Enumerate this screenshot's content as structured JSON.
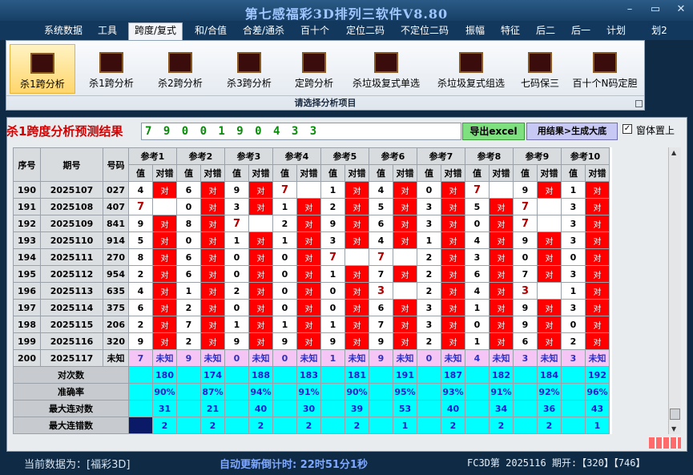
{
  "window": {
    "title": "第七感福彩3D排列三软件V8.80",
    "minimize": "–",
    "restore": "▭",
    "close": "✕"
  },
  "menu": [
    "系统数据",
    "工具",
    "跨度/复式",
    "和/合值",
    "合差/通杀",
    "百十个",
    "定位二码",
    "不定位二码",
    "振幅",
    "特征",
    "后二",
    "后一",
    "计划",
    "划2"
  ],
  "menu_active_index": 2,
  "ribbon": {
    "buttons": [
      "杀1跨分析",
      "杀1跨分析",
      "杀2跨分析",
      "杀3跨分析",
      "定跨分析",
      "杀垃圾复式单选",
      "杀垃圾复式组选",
      "七码保三",
      "百十个N码定胆"
    ],
    "selected_index": 0,
    "caption": "请选择分析项目"
  },
  "prediction": {
    "title": "杀1跨度分析预测结果",
    "result": "7 9 0 0 1 9 0 4 3 3",
    "export_button": "导出excel",
    "generate_button": "用结果>生成大底",
    "pin_label": "窗体置上",
    "pin_checked": "✓"
  },
  "table": {
    "headers": {
      "seq": "序号",
      "period": "期号",
      "number": "号码"
    },
    "refs": [
      "参考1",
      "参考2",
      "参考3",
      "参考4",
      "参考5",
      "参考6",
      "参考7",
      "参考8",
      "参考9",
      "参考10"
    ],
    "sub_value": "值",
    "sub_result": "对错",
    "hit_text": "对",
    "rows": [
      {
        "seq": "190",
        "period": "2025107",
        "number": "027",
        "cells": [
          [
            "4",
            "h"
          ],
          [
            "6",
            "h"
          ],
          [
            "9",
            "h"
          ],
          [
            "7",
            "m"
          ],
          [
            "1",
            "h"
          ],
          [
            "4",
            "h"
          ],
          [
            "0",
            "h"
          ],
          [
            "7",
            "m"
          ],
          [
            "9",
            "h"
          ],
          [
            "1",
            "h"
          ]
        ]
      },
      {
        "seq": "191",
        "period": "2025108",
        "number": "407",
        "cells": [
          [
            "7",
            "m"
          ],
          [
            "0",
            "h"
          ],
          [
            "3",
            "h"
          ],
          [
            "1",
            "h"
          ],
          [
            "2",
            "h"
          ],
          [
            "5",
            "h"
          ],
          [
            "3",
            "h"
          ],
          [
            "5",
            "h"
          ],
          [
            "7",
            "m"
          ],
          [
            "3",
            "h"
          ]
        ]
      },
      {
        "seq": "192",
        "period": "2025109",
        "number": "841",
        "cells": [
          [
            "9",
            "h"
          ],
          [
            "8",
            "h"
          ],
          [
            "7",
            "m"
          ],
          [
            "2",
            "h"
          ],
          [
            "9",
            "h"
          ],
          [
            "6",
            "h"
          ],
          [
            "3",
            "h"
          ],
          [
            "0",
            "h"
          ],
          [
            "7",
            "m"
          ],
          [
            "3",
            "h"
          ]
        ]
      },
      {
        "seq": "193",
        "period": "2025110",
        "number": "914",
        "cells": [
          [
            "5",
            "h"
          ],
          [
            "0",
            "h"
          ],
          [
            "1",
            "h"
          ],
          [
            "1",
            "h"
          ],
          [
            "3",
            "h"
          ],
          [
            "4",
            "h"
          ],
          [
            "1",
            "h"
          ],
          [
            "4",
            "h"
          ],
          [
            "9",
            "h"
          ],
          [
            "3",
            "h"
          ]
        ]
      },
      {
        "seq": "194",
        "period": "2025111",
        "number": "270",
        "cells": [
          [
            "8",
            "h"
          ],
          [
            "6",
            "h"
          ],
          [
            "0",
            "h"
          ],
          [
            "0",
            "h"
          ],
          [
            "7",
            "m"
          ],
          [
            "7",
            "m"
          ],
          [
            "2",
            "h"
          ],
          [
            "3",
            "h"
          ],
          [
            "0",
            "h"
          ],
          [
            "0",
            "h"
          ]
        ]
      },
      {
        "seq": "195",
        "period": "2025112",
        "number": "954",
        "cells": [
          [
            "2",
            "h"
          ],
          [
            "6",
            "h"
          ],
          [
            "0",
            "h"
          ],
          [
            "0",
            "h"
          ],
          [
            "1",
            "h"
          ],
          [
            "7",
            "h"
          ],
          [
            "2",
            "h"
          ],
          [
            "6",
            "h"
          ],
          [
            "7",
            "h"
          ],
          [
            "3",
            "h"
          ]
        ]
      },
      {
        "seq": "196",
        "period": "2025113",
        "number": "635",
        "cells": [
          [
            "4",
            "h"
          ],
          [
            "1",
            "h"
          ],
          [
            "2",
            "h"
          ],
          [
            "0",
            "h"
          ],
          [
            "0",
            "h"
          ],
          [
            "3",
            "m"
          ],
          [
            "2",
            "h"
          ],
          [
            "4",
            "h"
          ],
          [
            "3",
            "m"
          ],
          [
            "1",
            "h"
          ]
        ]
      },
      {
        "seq": "197",
        "period": "2025114",
        "number": "375",
        "cells": [
          [
            "6",
            "h"
          ],
          [
            "2",
            "h"
          ],
          [
            "0",
            "h"
          ],
          [
            "0",
            "h"
          ],
          [
            "0",
            "h"
          ],
          [
            "6",
            "h"
          ],
          [
            "3",
            "h"
          ],
          [
            "1",
            "h"
          ],
          [
            "9",
            "h"
          ],
          [
            "3",
            "h"
          ]
        ]
      },
      {
        "seq": "198",
        "period": "2025115",
        "number": "206",
        "cells": [
          [
            "2",
            "h"
          ],
          [
            "7",
            "h"
          ],
          [
            "1",
            "h"
          ],
          [
            "1",
            "h"
          ],
          [
            "1",
            "h"
          ],
          [
            "7",
            "h"
          ],
          [
            "3",
            "h"
          ],
          [
            "0",
            "h"
          ],
          [
            "9",
            "h"
          ],
          [
            "0",
            "h"
          ]
        ]
      },
      {
        "seq": "199",
        "period": "2025116",
        "number": "320",
        "cells": [
          [
            "9",
            "h"
          ],
          [
            "2",
            "h"
          ],
          [
            "9",
            "h"
          ],
          [
            "9",
            "h"
          ],
          [
            "9",
            "h"
          ],
          [
            "9",
            "h"
          ],
          [
            "2",
            "h"
          ],
          [
            "1",
            "h"
          ],
          [
            "6",
            "h"
          ],
          [
            "2",
            "h"
          ]
        ]
      }
    ],
    "next": {
      "seq": "200",
      "period": "2025117",
      "number": "未知",
      "values": [
        "7",
        "9",
        "0",
        "0",
        "1",
        "9",
        "0",
        "4",
        "3",
        "3"
      ],
      "status": "未知"
    },
    "stats": [
      {
        "label": "对次数",
        "values": [
          "180",
          "174",
          "188",
          "183",
          "181",
          "191",
          "187",
          "182",
          "184",
          "192"
        ]
      },
      {
        "label": "准确率",
        "values": [
          "90%",
          "87%",
          "94%",
          "91%",
          "90%",
          "95%",
          "93%",
          "91%",
          "92%",
          "96%"
        ]
      },
      {
        "label": "最大连对数",
        "values": [
          "31",
          "21",
          "40",
          "30",
          "39",
          "53",
          "40",
          "34",
          "36",
          "43"
        ]
      },
      {
        "label": "最大连错数",
        "values": [
          "2",
          "2",
          "2",
          "2",
          "2",
          "1",
          "2",
          "2",
          "2",
          "1"
        ]
      }
    ]
  },
  "status": {
    "data_label": "当前数据为：[福彩3D]",
    "countdown": "自动更新倒计时:  22时51分1秒",
    "issue": "FC3D第 2025116 期开:【320】【746】"
  },
  "colors": {
    "hit": "#ff0000",
    "miss_text": "#b00000",
    "stat_bg": "#00ffff",
    "unknown_bg": "#f5c6f5"
  }
}
